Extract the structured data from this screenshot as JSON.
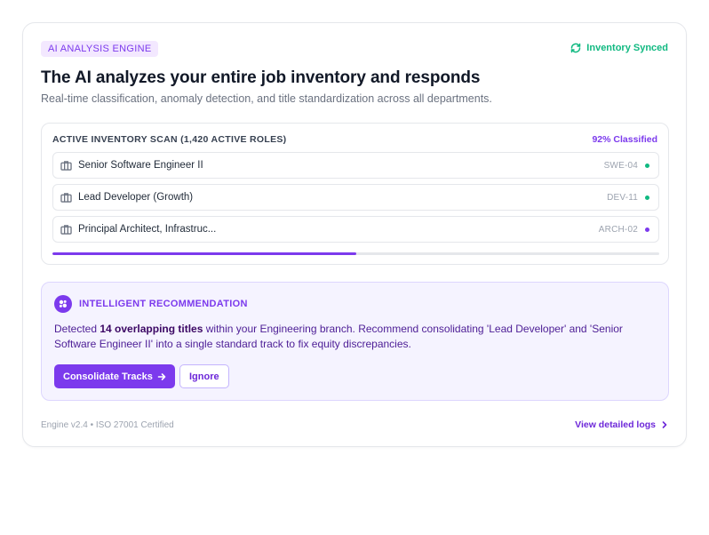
{
  "header": {
    "badge": "AI ANALYSIS ENGINE",
    "sync_status": "Inventory Synced",
    "sync_icon": "refresh-icon",
    "title": "The AI analyzes your entire job inventory and responds",
    "subtitle": "Real-time classification, anomaly detection, and title standardization across all departments."
  },
  "scan": {
    "heading": "ACTIVE INVENTORY SCAN (1,420 ACTIVE ROLES)",
    "classified_label": "92% Classified",
    "progress_fraction": 0.5,
    "roles": [
      {
        "title": "Senior Software Engineer II",
        "code": "SWE-04",
        "status_color": "#10b981"
      },
      {
        "title": "Lead Developer (Growth)",
        "code": "DEV-11",
        "status_color": "#10b981"
      },
      {
        "title": "Principal Architect, Infrastruc...",
        "code": "ARCH-02",
        "status_color": "#7c3aed"
      }
    ]
  },
  "recommendation": {
    "heading": "INTELLIGENT RECOMMENDATION",
    "text_before": "Detected ",
    "text_bold": "14 overlapping titles",
    "text_after": " within your Engineering branch. Recommend consolidating 'Lead Developer' and 'Senior Software Engineer II' into a single standard track to fix equity discrepancies.",
    "primary_button": "Consolidate Tracks",
    "secondary_button": "Ignore"
  },
  "footer": {
    "version": "Engine v2.4 • ISO 27001 Certified",
    "link": "View detailed logs"
  },
  "colors": {
    "accent": "#7c3aed",
    "success": "#10b981"
  }
}
